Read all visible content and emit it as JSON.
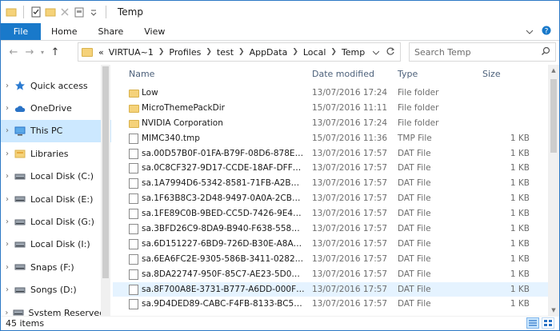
{
  "window": {
    "title": "Temp"
  },
  "ribbon": {
    "file_label": "File",
    "tabs": [
      "Home",
      "Share",
      "View"
    ]
  },
  "address": {
    "crumbs": [
      "VIRTUA~1",
      "Profiles",
      "test",
      "AppData",
      "Local",
      "Temp"
    ],
    "overflow": "«"
  },
  "search": {
    "placeholder": "Search Temp"
  },
  "nav": {
    "items": [
      {
        "label": "Quick access",
        "icon": "star-icon"
      },
      {
        "label": "OneDrive",
        "icon": "cloud-icon"
      },
      {
        "label": "This PC",
        "icon": "computer-icon",
        "selected": true
      },
      {
        "label": "Libraries",
        "icon": "libraries-icon"
      },
      {
        "label": "Local Disk (C:)",
        "icon": "drive-icon"
      },
      {
        "label": "Local Disk (E:)",
        "icon": "drive-icon"
      },
      {
        "label": "Local Disk (G:)",
        "icon": "drive-icon"
      },
      {
        "label": "Local Disk (I:)",
        "icon": "drive-icon"
      },
      {
        "label": "Snaps (F:)",
        "icon": "drive-icon"
      },
      {
        "label": "Songs (D:)",
        "icon": "drive-icon"
      },
      {
        "label": "System Reserved (",
        "icon": "drive-icon"
      }
    ]
  },
  "columns": {
    "name": "Name",
    "date": "Date modified",
    "type": "Type",
    "size": "Size"
  },
  "files": [
    {
      "name": "Low",
      "date": "13/07/2016 17:24",
      "type": "File folder",
      "size": "",
      "kind": "folder"
    },
    {
      "name": "MicroThemePackDir",
      "date": "15/07/2016 11:11",
      "type": "File folder",
      "size": "",
      "kind": "folder"
    },
    {
      "name": "NVIDIA Corporation",
      "date": "13/07/2016 17:24",
      "type": "File folder",
      "size": "",
      "kind": "folder"
    },
    {
      "name": "MIMC340.tmp",
      "date": "15/07/2016 11:36",
      "type": "TMP File",
      "size": "1 KB",
      "kind": "doc"
    },
    {
      "name": "sa.00D57B0F-01FA-B79F-08D6-878ED20C...",
      "date": "13/07/2016 17:57",
      "type": "DAT File",
      "size": "1 KB",
      "kind": "doc"
    },
    {
      "name": "sa.0C8CF327-9D17-CCDE-18AF-DFF4F20...",
      "date": "13/07/2016 17:57",
      "type": "DAT File",
      "size": "1 KB",
      "kind": "doc"
    },
    {
      "name": "sa.1A7994D6-5342-8581-71FB-A2BD1C89...",
      "date": "13/07/2016 17:57",
      "type": "DAT File",
      "size": "1 KB",
      "kind": "doc"
    },
    {
      "name": "sa.1F63B8C3-2D48-9497-0A0A-2CBD462E...",
      "date": "13/07/2016 17:57",
      "type": "DAT File",
      "size": "1 KB",
      "kind": "doc"
    },
    {
      "name": "sa.1FE89C0B-9BED-CC5D-7426-9E4025D6...",
      "date": "13/07/2016 17:57",
      "type": "DAT File",
      "size": "1 KB",
      "kind": "doc"
    },
    {
      "name": "sa.3BFD26C9-8DA9-B940-F638-55890012...",
      "date": "13/07/2016 17:57",
      "type": "DAT File",
      "size": "1 KB",
      "kind": "doc"
    },
    {
      "name": "sa.6D151227-6BD9-726D-B30E-A8A018D...",
      "date": "13/07/2016 17:57",
      "type": "DAT File",
      "size": "1 KB",
      "kind": "doc"
    },
    {
      "name": "sa.6EA6FC2E-9305-586B-3411-02826D151...",
      "date": "13/07/2016 17:57",
      "type": "DAT File",
      "size": "1 KB",
      "kind": "doc"
    },
    {
      "name": "sa.8DA22747-950F-85C7-AE23-5D05E473...",
      "date": "13/07/2016 17:57",
      "type": "DAT File",
      "size": "1 KB",
      "kind": "doc"
    },
    {
      "name": "sa.8F700A8E-3731-B777-A6DD-000FE1F8F...",
      "date": "13/07/2016 17:57",
      "type": "DAT File",
      "size": "1 KB",
      "kind": "doc",
      "highlighted": true
    },
    {
      "name": "sa.9D4DED89-CABC-F4FB-8133-BC5EDB1...",
      "date": "13/07/2016 17:57",
      "type": "DAT File",
      "size": "1 KB",
      "kind": "doc"
    }
  ],
  "status": {
    "item_count": "45 items"
  },
  "colors": {
    "accent": "#1979ca",
    "selected": "#cce8ff",
    "hover": "#e5f3ff",
    "folder": "#f5d27a"
  }
}
